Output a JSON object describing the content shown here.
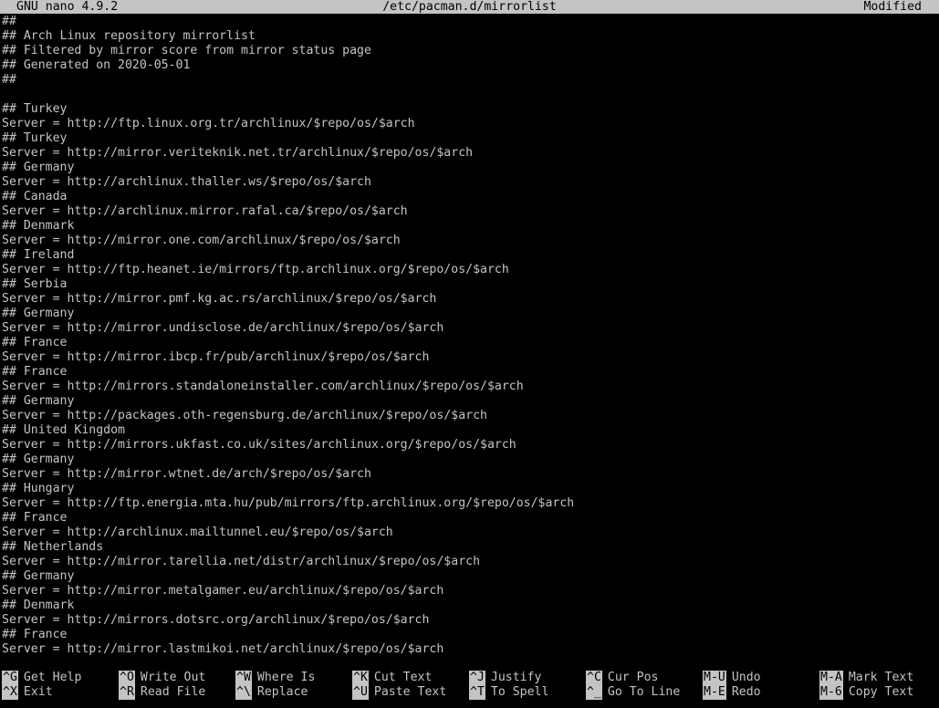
{
  "titlebar": {
    "app": "GNU nano 4.9.2",
    "file": "/etc/pacman.d/mirrorlist",
    "status": "Modified"
  },
  "lines": [
    "##",
    "## Arch Linux repository mirrorlist",
    "## Filtered by mirror score from mirror status page",
    "## Generated on 2020-05-01",
    "##",
    "",
    "## Turkey",
    "Server = http://ftp.linux.org.tr/archlinux/$repo/os/$arch",
    "## Turkey",
    "Server = http://mirror.veriteknik.net.tr/archlinux/$repo/os/$arch",
    "## Germany",
    "Server = http://archlinux.thaller.ws/$repo/os/$arch",
    "## Canada",
    "Server = http://archlinux.mirror.rafal.ca/$repo/os/$arch",
    "## Denmark",
    "Server = http://mirror.one.com/archlinux/$repo/os/$arch",
    "## Ireland",
    "Server = http://ftp.heanet.ie/mirrors/ftp.archlinux.org/$repo/os/$arch",
    "## Serbia",
    "Server = http://mirror.pmf.kg.ac.rs/archlinux/$repo/os/$arch",
    "## Germany",
    "Server = http://mirror.undisclose.de/archlinux/$repo/os/$arch",
    "## France",
    "Server = http://mirror.ibcp.fr/pub/archlinux/$repo/os/$arch",
    "## France",
    "Server = http://mirrors.standaloneinstaller.com/archlinux/$repo/os/$arch",
    "## Germany",
    "Server = http://packages.oth-regensburg.de/archlinux/$repo/os/$arch",
    "## United Kingdom",
    "Server = http://mirrors.ukfast.co.uk/sites/archlinux.org/$repo/os/$arch",
    "## Germany",
    "Server = http://mirror.wtnet.de/arch/$repo/os/$arch",
    "## Hungary",
    "Server = http://ftp.energia.mta.hu/pub/mirrors/ftp.archlinux.org/$repo/os/$arch",
    "## France",
    "Server = http://archlinux.mailtunnel.eu/$repo/os/$arch",
    "## Netherlands",
    "Server = http://mirror.tarellia.net/distr/archlinux/$repo/os/$arch",
    "## Germany",
    "Server = http://mirror.metalgamer.eu/archlinux/$repo/os/$arch",
    "## Denmark",
    "Server = http://mirrors.dotsrc.org/archlinux/$repo/os/$arch",
    "## France",
    "Server = http://mirror.lastmikoi.net/archlinux/$repo/os/$arch"
  ],
  "shortcuts": [
    {
      "key": "^G",
      "label": "Get Help"
    },
    {
      "key": "^X",
      "label": "Exit"
    },
    {
      "key": "^O",
      "label": "Write Out"
    },
    {
      "key": "^R",
      "label": "Read File"
    },
    {
      "key": "^W",
      "label": "Where Is"
    },
    {
      "key": "^\\",
      "label": "Replace"
    },
    {
      "key": "^K",
      "label": "Cut Text"
    },
    {
      "key": "^U",
      "label": "Paste Text"
    },
    {
      "key": "^J",
      "label": "Justify"
    },
    {
      "key": "^T",
      "label": "To Spell"
    },
    {
      "key": "^C",
      "label": "Cur Pos"
    },
    {
      "key": "^_",
      "label": "Go To Line"
    },
    {
      "key": "M-U",
      "label": "Undo"
    },
    {
      "key": "M-E",
      "label": "Redo"
    },
    {
      "key": "M-A",
      "label": "Mark Text"
    },
    {
      "key": "M-6",
      "label": "Copy Text"
    }
  ]
}
